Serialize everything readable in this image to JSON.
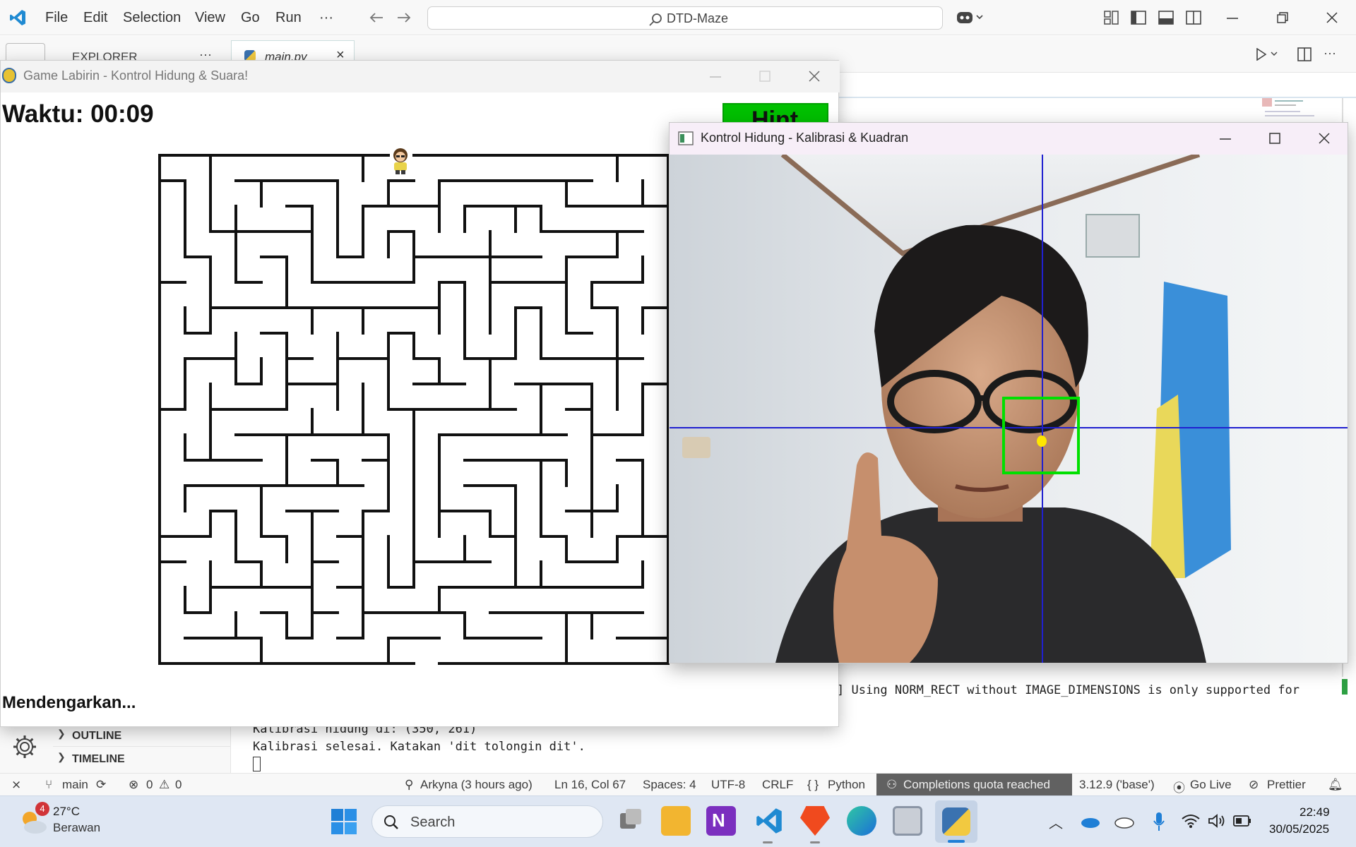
{
  "vscode": {
    "menu": [
      "File",
      "Edit",
      "Selection",
      "View",
      "Go",
      "Run",
      "···"
    ],
    "search_text": "DTD-Maze",
    "explorer_label": "EXPLORER",
    "explorer_more": "···",
    "tab_label": "main.py",
    "editor_actions_more": "···",
    "terminal_warning": "] Using NORM_RECT without IMAGE_DIMENSIONS is only supported for",
    "terminal_lines": [
      "Kalibrasi hidung di: (350, 261)",
      "Kalibrasi selesai. Katakan 'dit tolongin dit'."
    ],
    "sidebar_sections": [
      "OUTLINE",
      "TIMELINE"
    ],
    "accent": "#007acc"
  },
  "statusbar": {
    "branch": "main",
    "errors": "0",
    "warnings": "0",
    "blame": "Arkyna (3 hours ago)",
    "position": "Ln 16, Col 67",
    "spaces": "Spaces: 4",
    "encoding": "UTF-8",
    "eol": "CRLF",
    "language": "Python",
    "language_icon": "{ }",
    "copilot": "Completions quota reached",
    "interpreter": "3.12.9 ('base')",
    "golive": "Go Live",
    "prettier": "Prettier"
  },
  "game": {
    "window_title": "Game Labirin - Kontrol Hidung & Suara!",
    "timer": "Waktu: 00:09",
    "hint_label": "Hint",
    "hint_color": "#00c000",
    "status_text": "Mendengarkan..."
  },
  "camera": {
    "window_title": "Kontrol Hidung - Kalibrasi & Kuadran",
    "crosshair_color": "#2020d0",
    "box_color": "#00e000",
    "nose_color": "#ffe600"
  },
  "taskbar": {
    "weather_temp": "27°C",
    "weather_desc": "Berawan",
    "weather_badge": "4",
    "search_placeholder": "Search",
    "time": "22:49",
    "date": "30/05/2025"
  }
}
